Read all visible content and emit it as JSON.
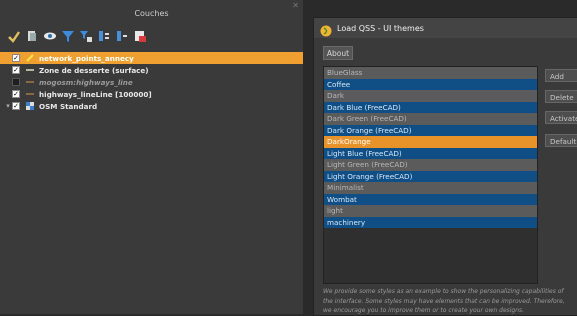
{
  "layers_panel": {
    "title": "Couches",
    "toolbar": [
      {
        "name": "add-layer-icon"
      },
      {
        "name": "layer-properties-icon"
      },
      {
        "name": "visibility-eye-icon"
      },
      {
        "name": "filter-icon"
      },
      {
        "name": "filter-legend-icon"
      },
      {
        "name": "expand-all-icon"
      },
      {
        "name": "collapse-all-icon"
      },
      {
        "name": "remove-layer-icon"
      }
    ],
    "layers": [
      {
        "label": "network_points_annecy",
        "checked": true,
        "selected": true,
        "italic": false,
        "symbol": "point"
      },
      {
        "label": "Zone de desserte (surface)",
        "checked": true,
        "selected": false,
        "italic": false,
        "symbol": "line"
      },
      {
        "label": "mogosm:highways_line",
        "checked": false,
        "selected": false,
        "italic": true,
        "symbol": "line"
      },
      {
        "label": "highways_lineLine [100000]",
        "checked": true,
        "selected": false,
        "italic": false,
        "symbol": "line"
      },
      {
        "label": "OSM Standard",
        "checked": true,
        "selected": false,
        "italic": false,
        "symbol": "raster"
      }
    ]
  },
  "dialog": {
    "title": "Load QSS - UI themes",
    "about_label": "About",
    "themes": [
      {
        "label": "BlueGlass",
        "style": "dark"
      },
      {
        "label": "Coffee",
        "style": "blue"
      },
      {
        "label": "Dark",
        "style": "dark"
      },
      {
        "label": "Dark Blue (FreeCAD)",
        "style": "blue"
      },
      {
        "label": "Dark Green (FreeCAD)",
        "style": "dark"
      },
      {
        "label": "Dark Orange (FreeCAD)",
        "style": "blue"
      },
      {
        "label": "DarkOrange",
        "style": "sel"
      },
      {
        "label": "Light Blue (FreeCAD)",
        "style": "blue"
      },
      {
        "label": "Light Green (FreeCAD)",
        "style": "dark"
      },
      {
        "label": "Light Orange (FreeCAD)",
        "style": "blue"
      },
      {
        "label": "Minimalist",
        "style": "dark"
      },
      {
        "label": "Wombat",
        "style": "blue"
      },
      {
        "label": "light",
        "style": "dark"
      },
      {
        "label": "machinery",
        "style": "blue"
      }
    ],
    "buttons": {
      "add": "Add",
      "delete": "Delete",
      "activate": "Activate",
      "default": "Default"
    },
    "note_lines": [
      "We provide some styles as an example to show the personalizing capabilities of",
      "the interface. Some styles may have elements that can be improved. Therefore,",
      "we encourage you to improve them or to create your own designs."
    ]
  },
  "colors": {
    "selection": "#f0a030",
    "blue_row": "#0f4f86",
    "dark_row": "#5b5b5b"
  }
}
